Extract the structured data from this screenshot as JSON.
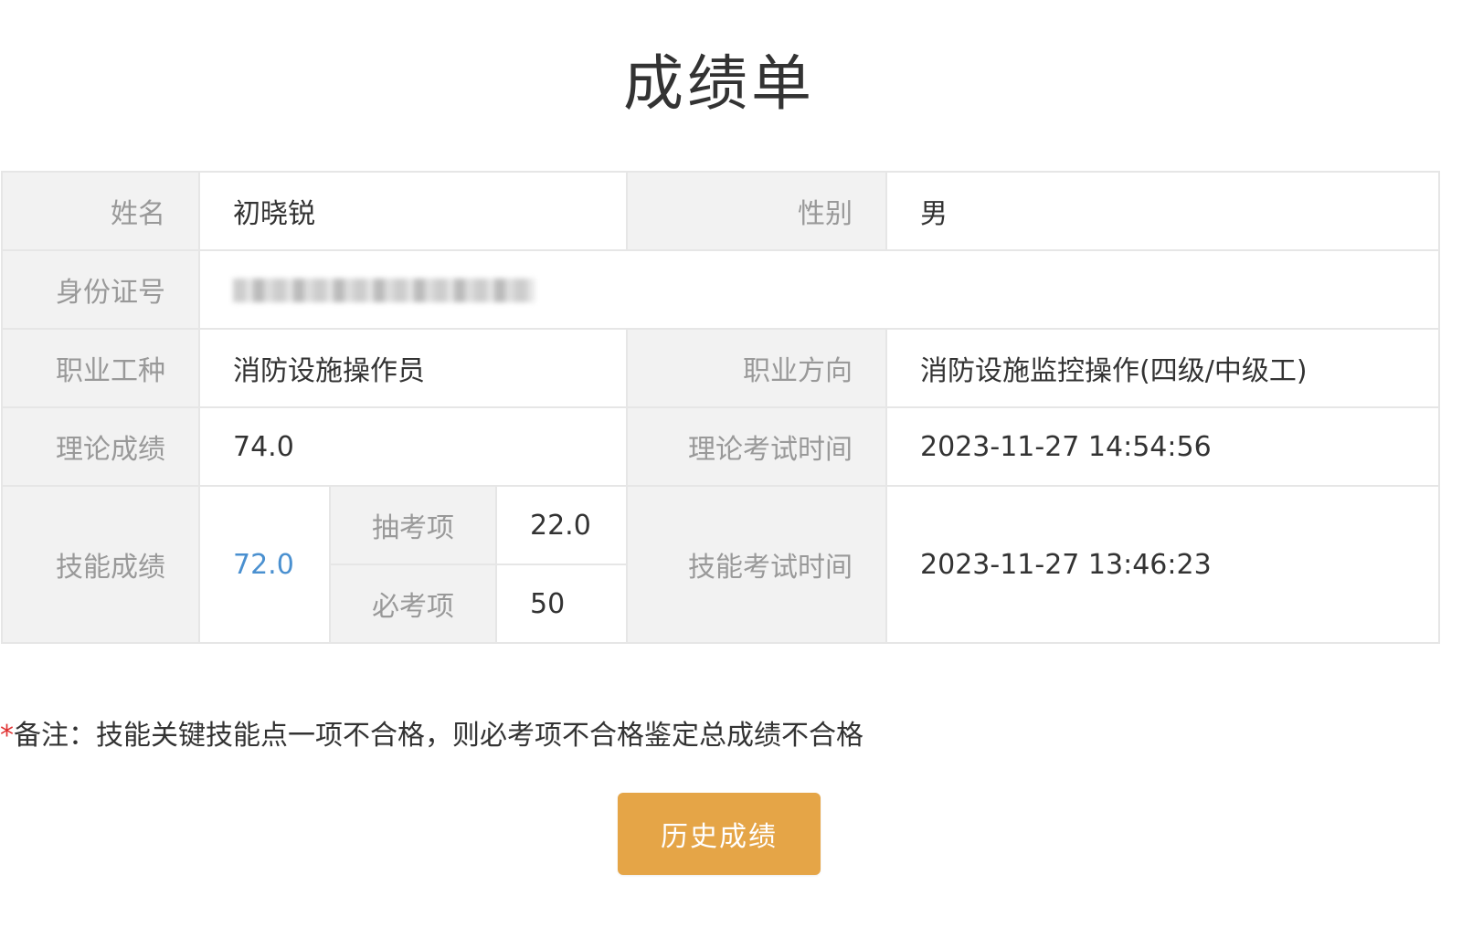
{
  "page": {
    "title": "成绩单"
  },
  "table": {
    "name_label": "姓名",
    "name_value": "初晓锐",
    "gender_label": "性别",
    "gender_value": "男",
    "id_label": "身份证号",
    "occupation_label": "职业工种",
    "occupation_value": "消防设施操作员",
    "direction_label": "职业方向",
    "direction_value": "消防设施监控操作(四级/中级工)",
    "theory_score_label": "理论成绩",
    "theory_score_value": "74.0",
    "theory_time_label": "理论考试时间",
    "theory_time_value": "2023-11-27 14:54:56",
    "skill_score_label": "技能成绩",
    "skill_score_value": "72.0",
    "sampled_item_label": "抽考项",
    "sampled_item_value": "22.0",
    "required_item_label": "必考项",
    "required_item_value": "50",
    "skill_time_label": "技能考试时间",
    "skill_time_value": "2023-11-27 13:46:23"
  },
  "note": {
    "asterisk": "*",
    "text": "备注：技能关键技能点一项不合格，则必考项不合格鉴定总成绩不合格"
  },
  "actions": {
    "history_label": "历史成绩"
  },
  "colors": {
    "button_bg": "#e5a547",
    "label_bg": "#f2f2f2",
    "skill_score_color": "#4a90d0",
    "asterisk_color": "#e03030"
  }
}
